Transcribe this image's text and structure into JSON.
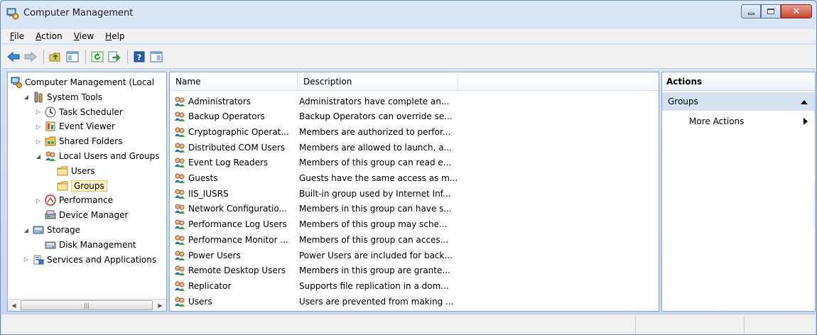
{
  "window": {
    "title": "Computer Management"
  },
  "menu": [
    {
      "label": "File",
      "key": "F",
      "rest": "ile"
    },
    {
      "label": "Action",
      "key": "A",
      "rest": "ction"
    },
    {
      "label": "View",
      "key": "V",
      "rest": "iew"
    },
    {
      "label": "Help",
      "key": "H",
      "rest": "elp"
    }
  ],
  "toolbar": [
    "back-arrow-icon",
    "forward-arrow-icon",
    "up-folder-icon",
    "show-hide-tree-icon",
    "refresh-icon",
    "export-list-icon",
    "help-icon",
    "show-hide-action-pane-icon"
  ],
  "tree": [
    {
      "label": "Computer Management (Local",
      "indent": 0,
      "expander": "",
      "icon": "computer-management-icon"
    },
    {
      "label": "System Tools",
      "indent": 1,
      "expander": "◢",
      "icon": "system-tools-icon"
    },
    {
      "label": "Task Scheduler",
      "indent": 2,
      "expander": "▷",
      "icon": "task-scheduler-icon"
    },
    {
      "label": "Event Viewer",
      "indent": 2,
      "expander": "▷",
      "icon": "event-viewer-icon"
    },
    {
      "label": "Shared Folders",
      "indent": 2,
      "expander": "▷",
      "icon": "shared-folders-icon"
    },
    {
      "label": "Local Users and Groups",
      "indent": 2,
      "expander": "◢",
      "icon": "users-groups-icon"
    },
    {
      "label": "Users",
      "indent": 3,
      "expander": "",
      "icon": "folder-icon"
    },
    {
      "label": "Groups",
      "indent": 3,
      "expander": "",
      "icon": "folder-icon",
      "selected": true
    },
    {
      "label": "Performance",
      "indent": 2,
      "expander": "▷",
      "icon": "performance-icon"
    },
    {
      "label": "Device Manager",
      "indent": 2,
      "expander": "",
      "icon": "device-manager-icon"
    },
    {
      "label": "Storage",
      "indent": 1,
      "expander": "◢",
      "icon": "storage-icon"
    },
    {
      "label": "Disk Management",
      "indent": 2,
      "expander": "",
      "icon": "disk-management-icon"
    },
    {
      "label": "Services and Applications",
      "indent": 1,
      "expander": "▷",
      "icon": "services-applications-icon"
    }
  ],
  "list": {
    "columns": [
      "Name",
      "Description"
    ],
    "rows": [
      {
        "name": "Administrators",
        "description": "Administrators have complete an..."
      },
      {
        "name": "Backup Operators",
        "description": "Backup Operators can override se..."
      },
      {
        "name": "Cryptographic Operat...",
        "description": "Members are authorized to perfor..."
      },
      {
        "name": "Distributed COM Users",
        "description": "Members are allowed to launch, a..."
      },
      {
        "name": "Event Log Readers",
        "description": "Members of this group can read e..."
      },
      {
        "name": "Guests",
        "description": "Guests have the same access as m..."
      },
      {
        "name": "IIS_IUSRS",
        "description": "Built-in group used by Internet Inf..."
      },
      {
        "name": "Network Configuratio...",
        "description": "Members in this group can have s..."
      },
      {
        "name": "Performance Log Users",
        "description": "Members of this group may sche..."
      },
      {
        "name": "Performance Monitor ...",
        "description": "Members of this group can acces..."
      },
      {
        "name": "Power Users",
        "description": "Power Users are included for back..."
      },
      {
        "name": "Remote Desktop Users",
        "description": "Members in this group are grante..."
      },
      {
        "name": "Replicator",
        "description": "Supports file replication in a dom..."
      },
      {
        "name": "Users",
        "description": "Users are prevented from making ..."
      }
    ]
  },
  "actions": {
    "header": "Actions",
    "section": "Groups",
    "items": [
      "More Actions"
    ]
  },
  "colors": {
    "accent": "#d6e2f2",
    "selection": "#fff3c6"
  }
}
